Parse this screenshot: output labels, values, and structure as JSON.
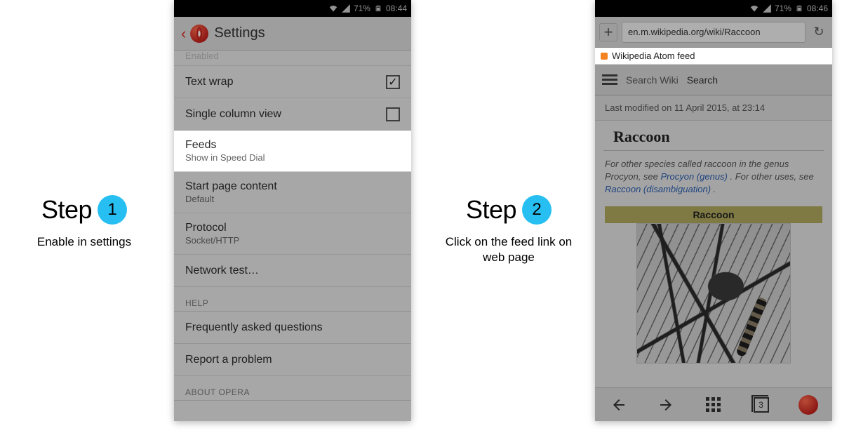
{
  "step1": {
    "word": "Step",
    "number": "1",
    "caption": "Enable in settings"
  },
  "step2": {
    "word": "Step",
    "number": "2",
    "caption": "Click on the feed link on web page"
  },
  "left_phone": {
    "status": {
      "battery_percent": "71%",
      "time": "08:44"
    },
    "header": {
      "title": "Settings"
    },
    "rows": {
      "enabled_cut": "Enabled",
      "text_wrap": "Text wrap",
      "single_column": "Single column view",
      "feeds": "Feeds",
      "feeds_sub": "Show in Speed Dial",
      "start_page": "Start page content",
      "start_page_sub": "Default",
      "protocol": "Protocol",
      "protocol_sub": "Socket/HTTP",
      "network_test": "Network test…"
    },
    "sections": {
      "help": "HELP",
      "about": "ABOUT OPERA"
    },
    "help_rows": {
      "faq": "Frequently asked questions",
      "report": "Report a problem"
    }
  },
  "right_phone": {
    "status": {
      "battery_percent": "71%",
      "time": "08:46"
    },
    "url": "en.m.wikipedia.org/wiki/Raccoon",
    "feed_label": "Wikipedia Atom feed",
    "wiki": {
      "search_placeholder": "Search Wiki",
      "search_button": "Search",
      "lastmod": "Last modified on 11 April 2015, at 23:14",
      "title": "Raccoon",
      "hatnote_pre": "For other species called raccoon in the genus Procyon, see ",
      "hatnote_link1": "Procyon (genus)",
      "hatnote_mid": ". For other uses, see ",
      "hatnote_link2": "Raccoon (disambiguation)",
      "hatnote_post": ".",
      "infobox_header": "Raccoon"
    },
    "tabs_count": "3"
  }
}
